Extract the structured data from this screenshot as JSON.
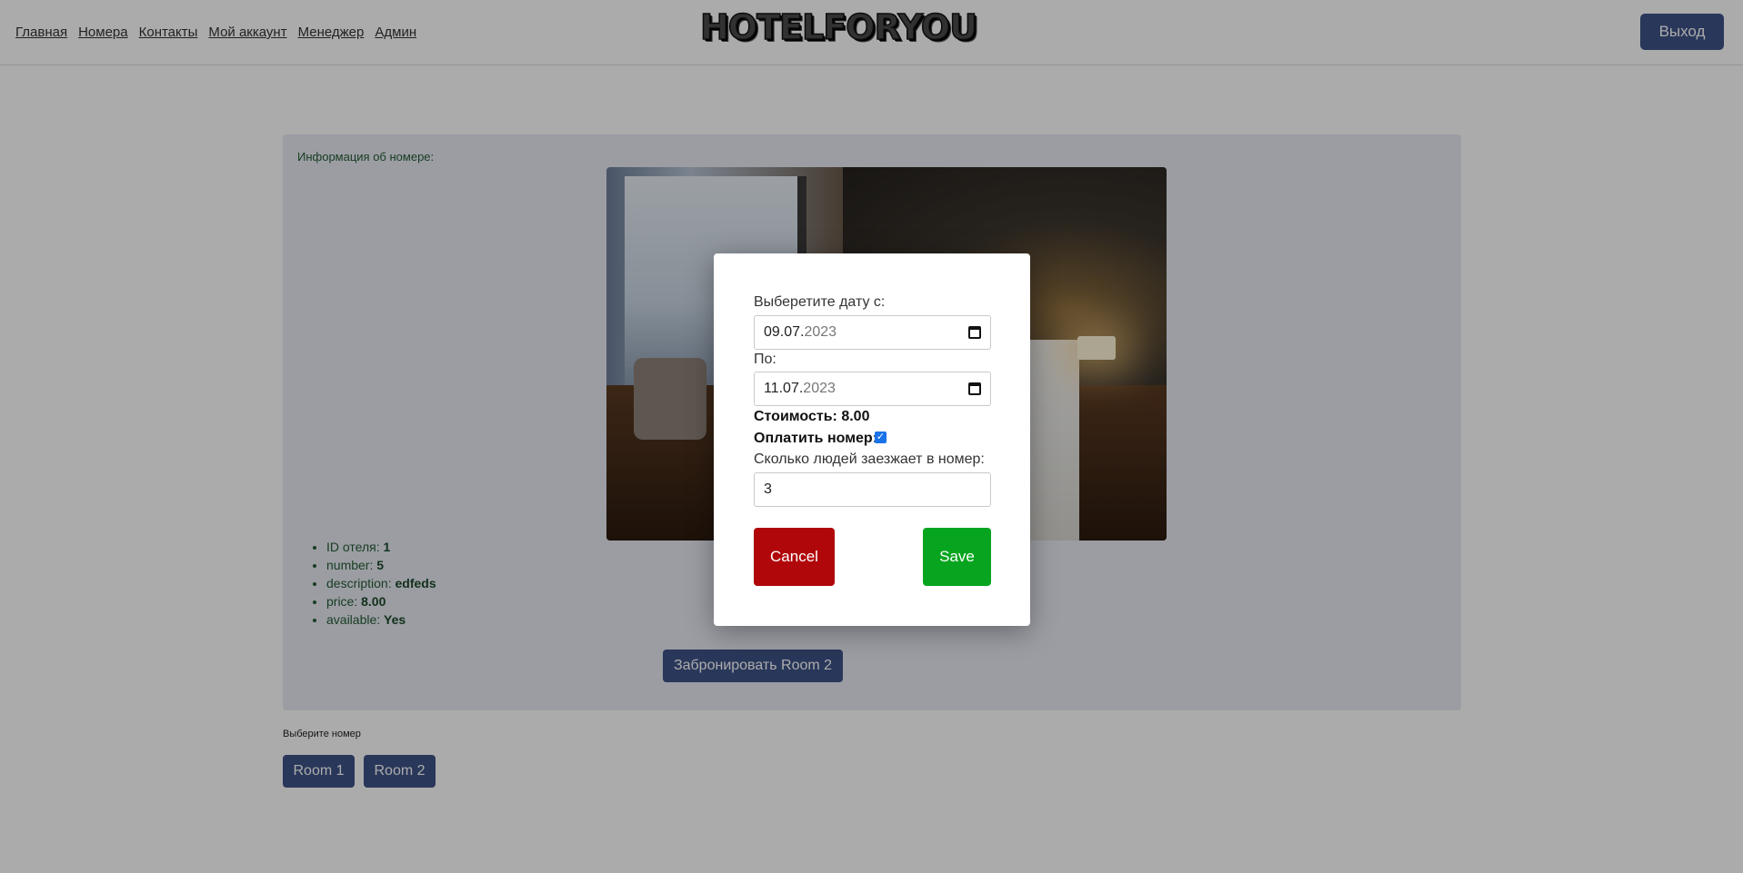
{
  "nav": {
    "items": [
      "Главная",
      "Номера",
      "Контакты",
      "Мой аккаунт",
      "Менеджер",
      "Админ"
    ]
  },
  "header": {
    "logo": "HOTELFORYOU",
    "logout_label": "Выход"
  },
  "card": {
    "title": "Информация об номере:",
    "details": [
      {
        "label": "ID отеля: ",
        "value": "1"
      },
      {
        "label": "number: ",
        "value": "5"
      },
      {
        "label": "description: ",
        "value": "edfeds"
      },
      {
        "label": "price: ",
        "value": "8.00"
      },
      {
        "label": "available: ",
        "value": "Yes"
      }
    ],
    "book_label": "Забронировать Room 2"
  },
  "rooms": {
    "choose_label": "Выберите номер",
    "buttons": [
      "Room 1",
      "Room 2"
    ]
  },
  "modal": {
    "from_label": "Выберетите дату с:",
    "from_date": "09.07.",
    "from_year": "2023",
    "to_label": "По:",
    "to_date": "11.07.",
    "to_year": "2023",
    "cost_text": "Стоимость: 8.00",
    "pay_label": "Оплатить номер:",
    "pay_checked": true,
    "people_label": "Сколько людей заезжает в номер:",
    "people_value": "3",
    "cancel_label": "Cancel",
    "save_label": "Save"
  },
  "colors": {
    "accent": "#3e5287",
    "cancel": "#b0070b",
    "save": "#07a51f",
    "card_bg": "#e7eaf3",
    "info_text": "#245c34"
  }
}
